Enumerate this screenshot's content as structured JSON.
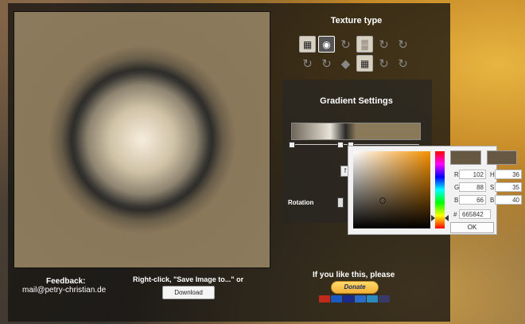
{
  "texture": {
    "title": "Texture type",
    "icons": [
      {
        "name": "tile-pattern-icon",
        "glyph": "▦",
        "state": "normal"
      },
      {
        "name": "radial-gradient-icon",
        "glyph": "◉",
        "state": "selected"
      },
      {
        "name": "refresh-icon",
        "glyph": "↻",
        "state": "disabled"
      },
      {
        "name": "noise-icon",
        "glyph": "▒",
        "state": "normal"
      },
      {
        "name": "refresh-icon",
        "glyph": "↻",
        "state": "disabled"
      },
      {
        "name": "refresh-icon",
        "glyph": "↻",
        "state": "disabled"
      },
      {
        "name": "refresh-icon",
        "glyph": "↻",
        "state": "disabled"
      },
      {
        "name": "refresh-icon",
        "glyph": "↻",
        "state": "disabled"
      },
      {
        "name": "diamond-pattern-icon",
        "glyph": "◆",
        "state": "disabled"
      },
      {
        "name": "grid-pattern-icon",
        "glyph": "▦",
        "state": "normal"
      },
      {
        "name": "refresh-icon",
        "glyph": "↻",
        "state": "disabled"
      },
      {
        "name": "refresh-icon",
        "glyph": "↻",
        "state": "disabled"
      }
    ]
  },
  "gradient": {
    "title": "Gradient Settings",
    "f_label": "f",
    "rotation_label": "Rotation"
  },
  "color_picker": {
    "r_label": "R",
    "r_value": "102",
    "g_label": "G",
    "g_value": "88",
    "b_label": "B",
    "b_value": "66",
    "h_label": "H",
    "h_value": "36",
    "s_label": "S",
    "s_value": "35",
    "v_label": "B",
    "v_value": "40",
    "hex_label": "#",
    "hex_value": "665842",
    "ok_label": "OK",
    "current_color": "#665842"
  },
  "footer": {
    "feedback_title": "Feedback:",
    "email": "mail@petry-christian.de",
    "save_hint": "Right-click, \"Save Image to...\" or",
    "download_label": "Download",
    "like_text": "If you like this, please",
    "donate_label": "Donate"
  },
  "payment_cards": [
    {
      "name": "mastercard-icon",
      "color": "#c02a1a"
    },
    {
      "name": "maestro-icon",
      "color": "#1a5ac0"
    },
    {
      "name": "visa-icon",
      "color": "#1a2a8a"
    },
    {
      "name": "visa-electron-icon",
      "color": "#2a6ac8"
    },
    {
      "name": "amex-icon",
      "color": "#2a8ac0"
    },
    {
      "name": "bank-card-icon",
      "color": "#3a3a6a"
    }
  ]
}
